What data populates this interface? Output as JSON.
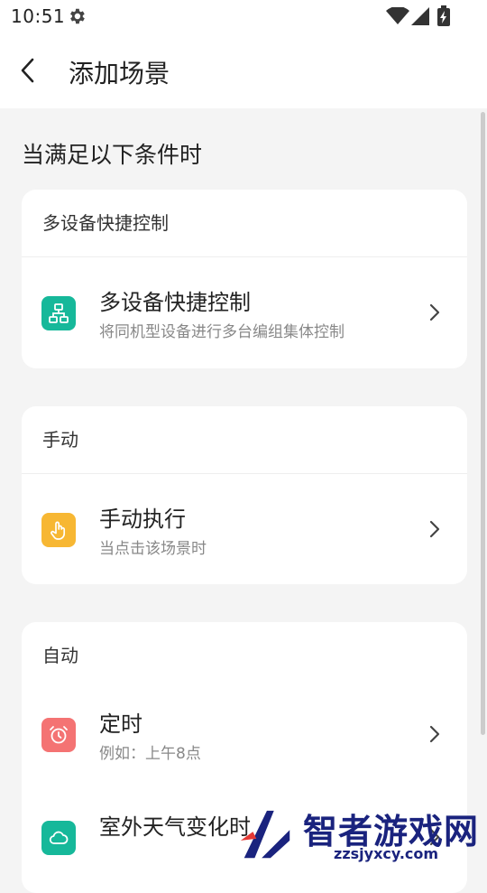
{
  "status": {
    "time": "10:51",
    "icons": [
      "gear-icon",
      "wifi-icon",
      "signal-icon",
      "battery-charging-icon"
    ]
  },
  "appbar": {
    "title": "添加场景",
    "back_icon": "chevron-left-icon"
  },
  "heading": "当满足以下条件时",
  "sections": [
    {
      "title": "多设备快捷控制",
      "items": [
        {
          "title": "多设备快捷控制",
          "subtitle": "将同机型设备进行多台编组集体控制",
          "icon": "device-group-icon",
          "color": "#16b89a"
        }
      ]
    },
    {
      "title": "手动",
      "items": [
        {
          "title": "手动执行",
          "subtitle": "当点击该场景时",
          "icon": "tap-hand-icon",
          "color": "#f7b733"
        }
      ]
    },
    {
      "title": "自动",
      "items": [
        {
          "title": "定时",
          "subtitle": "例如：上午8点",
          "icon": "alarm-clock-icon",
          "color": "#f47373"
        },
        {
          "title": "室外天气变化时",
          "subtitle": "",
          "icon": "cloud-icon",
          "color": "#16b89a"
        }
      ]
    }
  ],
  "watermark": {
    "text": "智者游戏网",
    "url": "zzsjyxcy.com"
  }
}
